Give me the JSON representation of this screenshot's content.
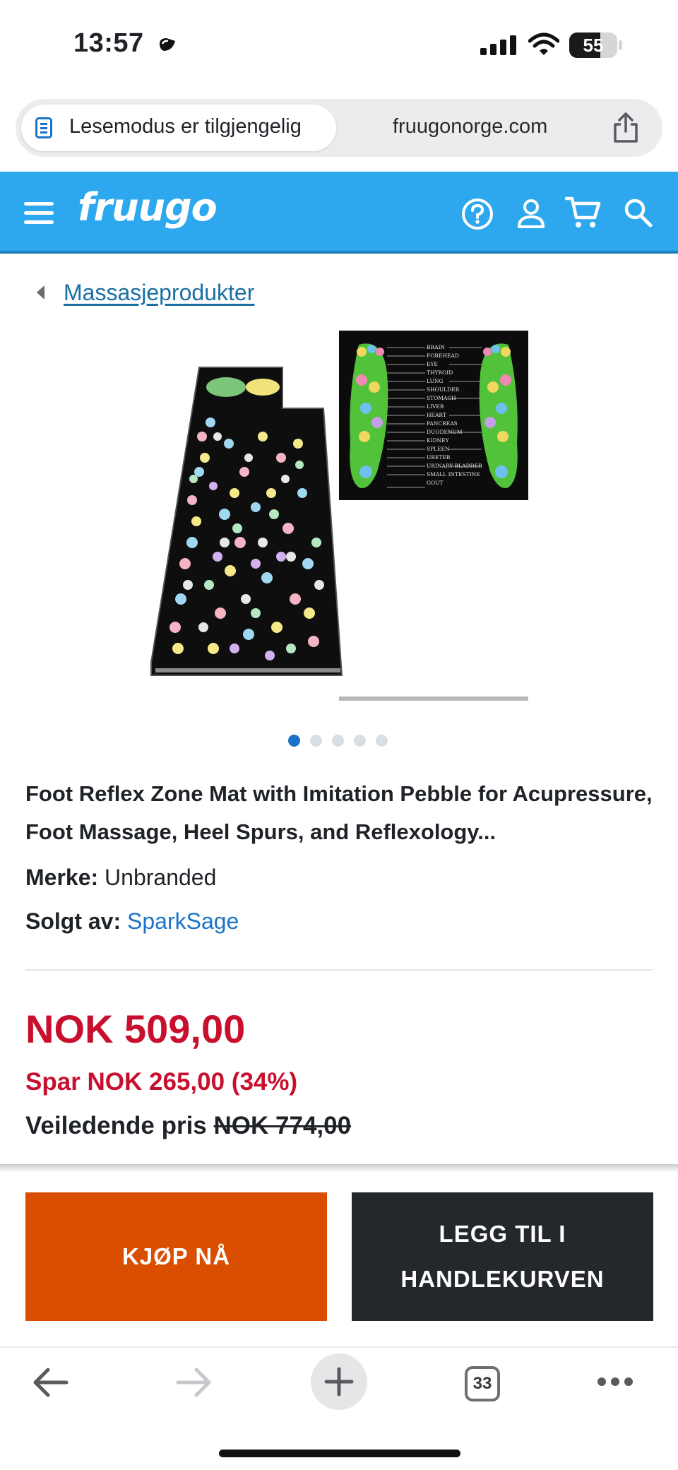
{
  "status_bar": {
    "time": "13:57",
    "battery": "55"
  },
  "browser": {
    "reader_mode_label": "Lesemodus er tilgjengelig",
    "domain": "fruugonorge.com",
    "tab_count": "33"
  },
  "header": {
    "logo": "fruugo",
    "brand_color": "#2da8ee"
  },
  "breadcrumb": {
    "label": "Massasjeprodukter"
  },
  "gallery": {
    "image_count": 5,
    "active_index": 0
  },
  "product": {
    "title": "Foot Reflex Zone Mat with Imitation Pebble for Acupressure, Foot Massage, Heel Spurs, and Reflexology...",
    "brand_label": "Merke:",
    "brand_value": "Unbranded",
    "seller_label": "Solgt av:",
    "seller_value": "SparkSage",
    "chart_labels": [
      "BRAIN",
      "FOREHEAD",
      "EYE",
      "THYROID",
      "LUNG",
      "SHOULDER",
      "STOMACH",
      "LIVER",
      "HEART",
      "PANCREAS",
      "DUODENUM",
      "KIDNEY",
      "SPLEEN",
      "URETER",
      "URINARY BLADDER",
      "SMALL INTESTINE",
      "GOUT"
    ]
  },
  "pricing": {
    "price": "NOK 509,00",
    "savings": "Spar NOK 265,00 (34%)",
    "rrp_label": "Veiledende pris",
    "rrp_value": "NOK 774,00",
    "price_color": "#c8102e"
  },
  "actions": {
    "buy_now": "KJØP NÅ",
    "add_to_cart_line1": "LEGG TIL I",
    "add_to_cart_line2": "HANDLEKURVEN",
    "buy_color": "#d94e00",
    "cart_color": "#24272b"
  }
}
